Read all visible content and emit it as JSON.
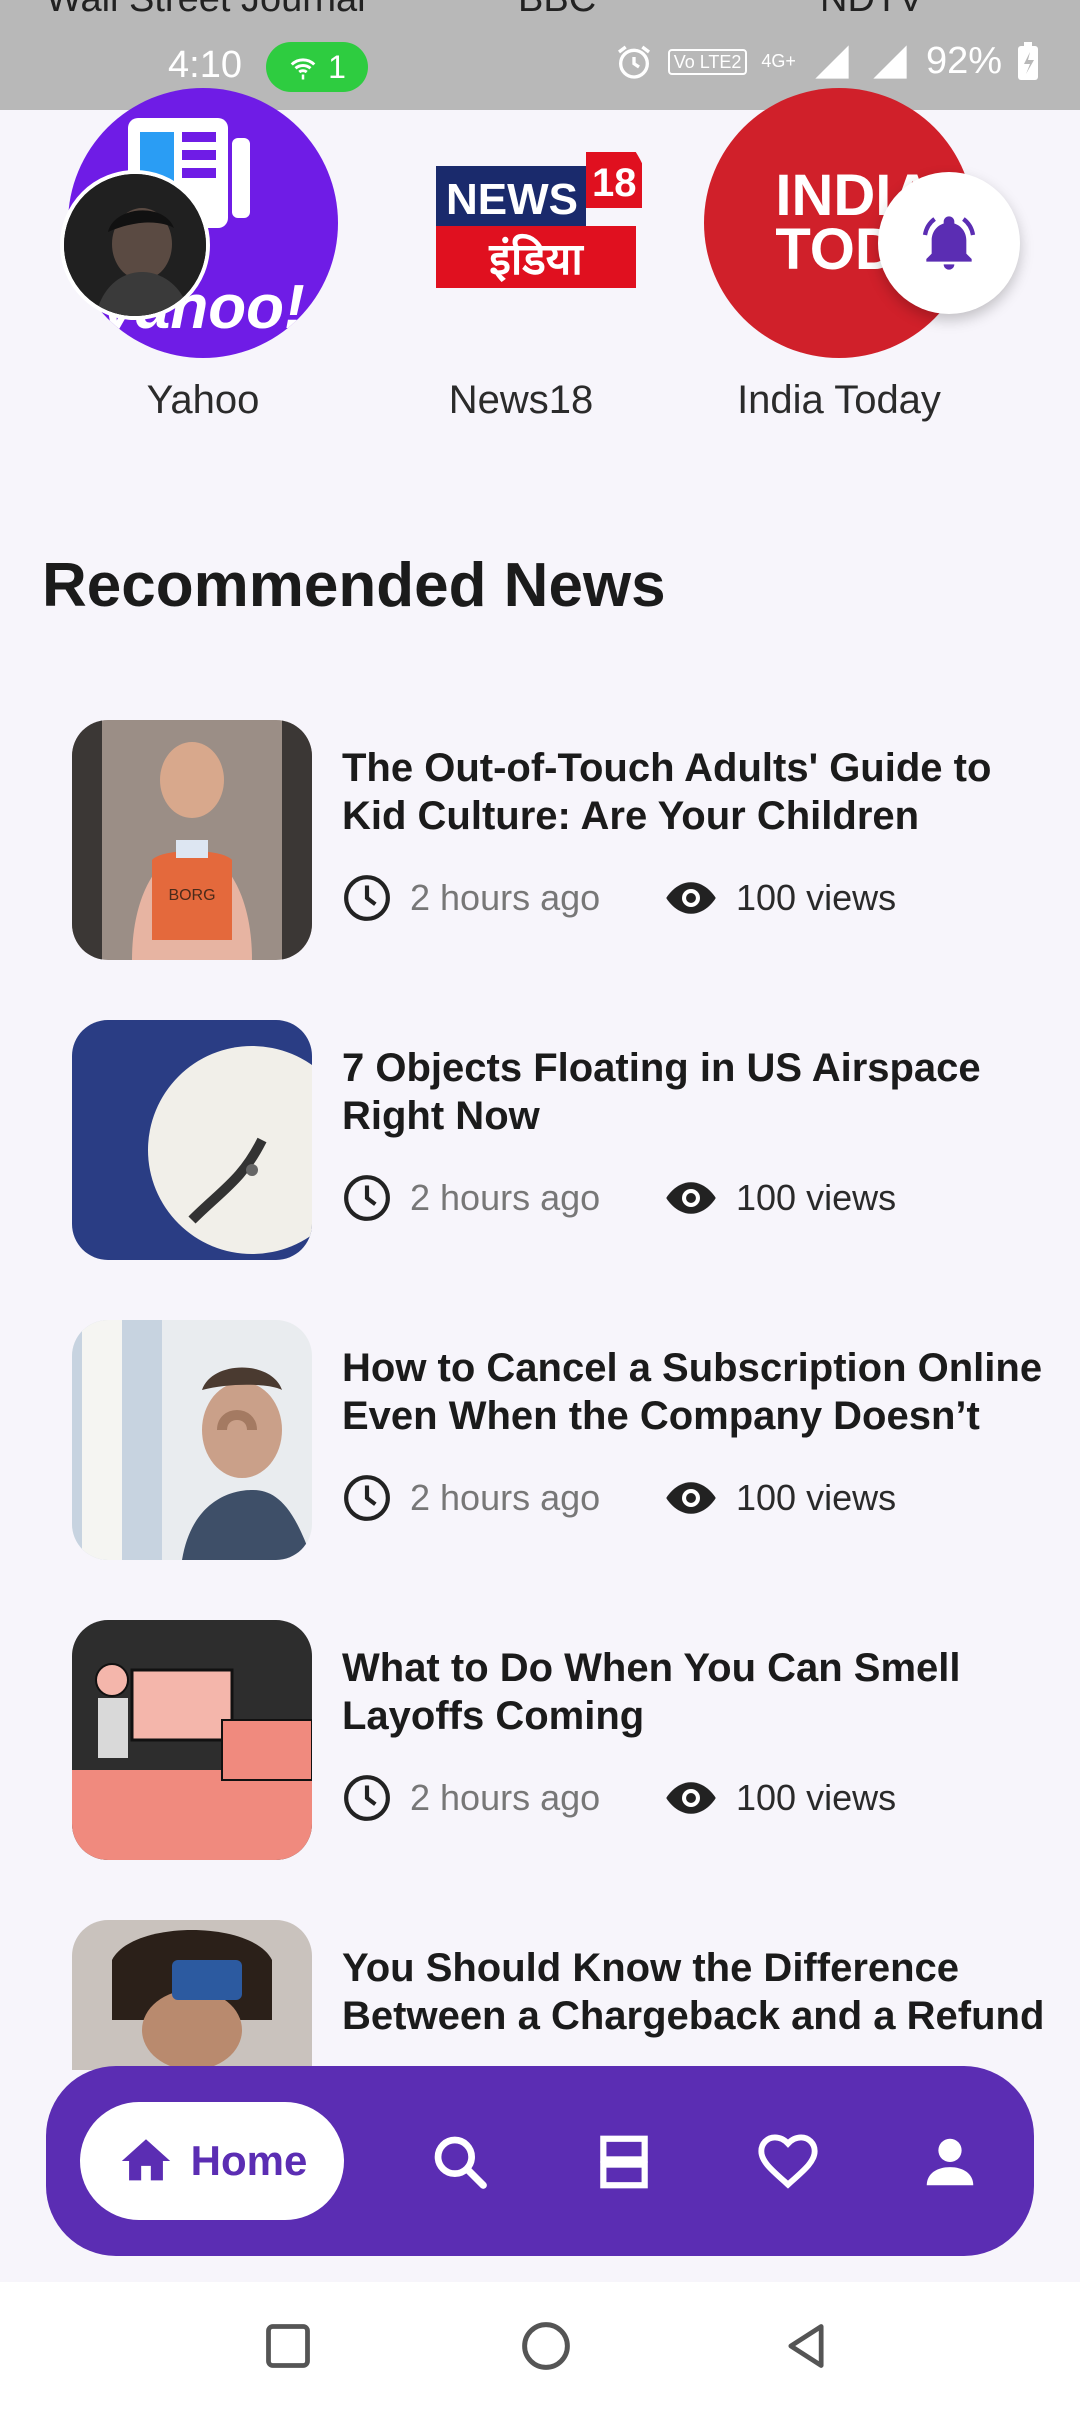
{
  "status_bar": {
    "time": "4:10",
    "hotspot_count": "1",
    "battery": "92%",
    "network": "4G+",
    "lte_label": "Vo LTE2"
  },
  "previous_sources": [
    "Wall Street Journal",
    "BBC",
    "NDTV"
  ],
  "sources": [
    {
      "name": "Yahoo",
      "icon": "yahoo-logo"
    },
    {
      "name": "News18",
      "icon": "news18-logo",
      "logo_top": "NEWS",
      "logo_badge": "18",
      "logo_bottom": "इंडिया"
    },
    {
      "name": "India Today",
      "icon": "india-today-logo",
      "logo_text_1": "INDIA",
      "logo_text_2": "TODA"
    }
  ],
  "section_title": "Recommended News",
  "news": [
    {
      "title": "The Out-of-Touch Adults' Guide to Kid Culture: Are Your Children",
      "time": "2 hours ago",
      "views": "100 views"
    },
    {
      "title": "7 Objects Floating in US Airspace Right Now",
      "time": "2 hours ago",
      "views": "100 views"
    },
    {
      "title": "How to Cancel a Subscription Online Even When the Company Doesn’t",
      "time": "2 hours ago",
      "views": "100 views"
    },
    {
      "title": "What to Do When You Can Smell Layoffs Coming",
      "time": "2 hours ago",
      "views": "100 views"
    },
    {
      "title": "You Should Know the Difference Between a Chargeback and a Refund",
      "time": "",
      "views": ""
    }
  ],
  "bottom_nav": {
    "home_label": "Home",
    "items": [
      "home-icon",
      "search-icon",
      "feeds-icon",
      "favorites-icon",
      "profile-icon"
    ]
  },
  "colors": {
    "accent": "#5b2db3",
    "yahoo": "#6f1ce6",
    "india_today": "#d0202a",
    "hotspot": "#2ecc40"
  }
}
